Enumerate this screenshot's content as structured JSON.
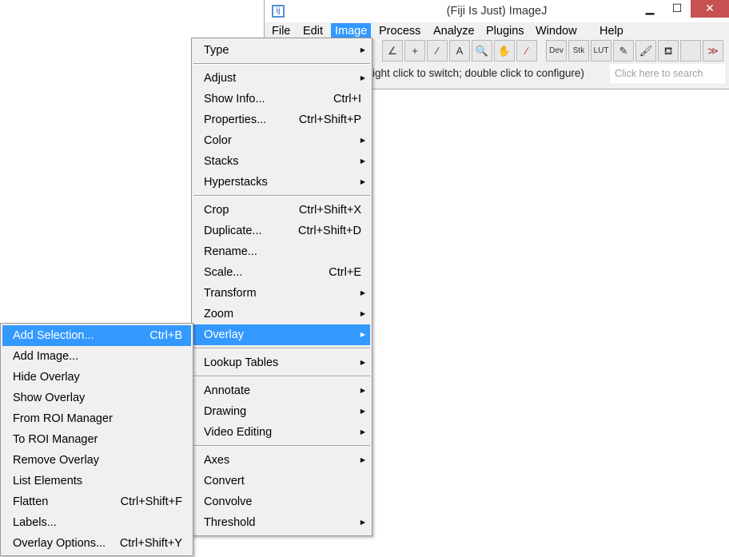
{
  "window": {
    "title": "(Fiji Is Just) ImageJ",
    "minimize": "▁",
    "maximize": "☐",
    "close": "✕"
  },
  "menubar": [
    {
      "label": "File"
    },
    {
      "label": "Edit"
    },
    {
      "label": "Image"
    },
    {
      "label": "Process"
    },
    {
      "label": "Analyze"
    },
    {
      "label": "Plugins"
    },
    {
      "label": "Window"
    },
    {
      "label": "Help"
    }
  ],
  "toolbar": {
    "tools": [
      {
        "icon": "angle-icon",
        "glyph": "∠"
      },
      {
        "icon": "point-icon",
        "glyph": "+"
      },
      {
        "icon": "wand-icon",
        "glyph": "⁄"
      },
      {
        "icon": "text-icon",
        "glyph": "A"
      },
      {
        "icon": "magnifier-icon",
        "glyph": "🔍"
      },
      {
        "icon": "hand-icon",
        "glyph": "✋"
      },
      {
        "icon": "dropper-icon",
        "glyph": "⁄"
      },
      {
        "icon": "dev-icon",
        "glyph": "Dev"
      },
      {
        "icon": "stk-icon",
        "glyph": "Stk"
      },
      {
        "icon": "lut-icon",
        "glyph": "LUT"
      },
      {
        "icon": "pencil-icon",
        "glyph": "✎"
      },
      {
        "icon": "brush-icon",
        "glyph": "🖌"
      },
      {
        "icon": "flood-fill-icon",
        "glyph": "⛾"
      },
      {
        "icon": "empty-slot",
        "glyph": ""
      },
      {
        "icon": "more-tools-icon",
        "glyph": "≫"
      }
    ],
    "status": "ight click to switch; double click to configure)",
    "search_placeholder": "Click here to search"
  },
  "image_menu": [
    {
      "label": "Type",
      "submenu": true
    },
    "sep",
    {
      "label": "Adjust",
      "submenu": true
    },
    {
      "label": "Show Info...",
      "shortcut": "Ctrl+I"
    },
    {
      "label": "Properties...",
      "shortcut": "Ctrl+Shift+P"
    },
    {
      "label": "Color",
      "submenu": true
    },
    {
      "label": "Stacks",
      "submenu": true
    },
    {
      "label": "Hyperstacks",
      "submenu": true
    },
    "sep",
    {
      "label": "Crop",
      "shortcut": "Ctrl+Shift+X"
    },
    {
      "label": "Duplicate...",
      "shortcut": "Ctrl+Shift+D"
    },
    {
      "label": "Rename..."
    },
    {
      "label": "Scale...",
      "shortcut": "Ctrl+E"
    },
    {
      "label": "Transform",
      "submenu": true
    },
    {
      "label": "Zoom",
      "submenu": true
    },
    {
      "label": "Overlay",
      "submenu": true,
      "highlighted": true
    },
    "sep",
    {
      "label": "Lookup Tables",
      "submenu": true
    },
    "sep",
    {
      "label": "Annotate",
      "submenu": true
    },
    {
      "label": "Drawing",
      "submenu": true
    },
    {
      "label": "Video Editing",
      "submenu": true
    },
    "sep",
    {
      "label": "Axes",
      "submenu": true
    },
    {
      "label": "Convert"
    },
    {
      "label": "Convolve"
    },
    {
      "label": "Threshold",
      "submenu": true
    }
  ],
  "overlay_menu": [
    {
      "label": "Add Selection...",
      "shortcut": "Ctrl+B",
      "highlighted": true
    },
    {
      "label": "Add Image..."
    },
    {
      "label": "Hide Overlay"
    },
    {
      "label": "Show Overlay"
    },
    {
      "label": "From ROI Manager"
    },
    {
      "label": "To ROI Manager"
    },
    {
      "label": "Remove Overlay"
    },
    {
      "label": "List Elements"
    },
    {
      "label": "Flatten",
      "shortcut": "Ctrl+Shift+F"
    },
    {
      "label": "Labels..."
    },
    {
      "label": "Overlay Options...",
      "shortcut": "Ctrl+Shift+Y"
    }
  ],
  "colors": {
    "highlight": "#3399ff",
    "close": "#c75050"
  }
}
